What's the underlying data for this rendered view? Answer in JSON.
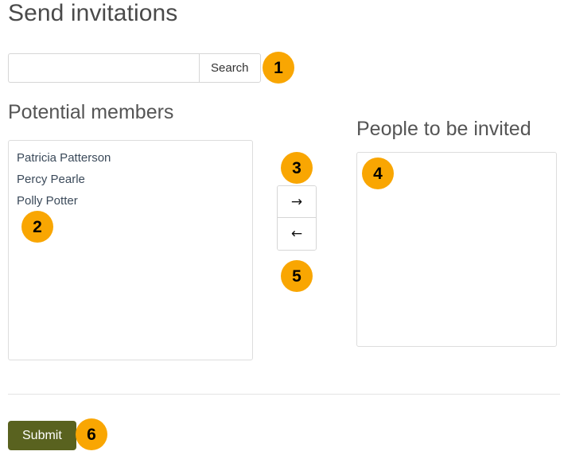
{
  "page": {
    "title": "Send invitations"
  },
  "search": {
    "value": "",
    "placeholder": "",
    "button_label": "Search"
  },
  "potential_members": {
    "heading": "Potential members",
    "options": [
      "Patricia Patterson",
      "Percy Pearle",
      "Polly Potter"
    ]
  },
  "invited": {
    "heading": "People to be invited",
    "options": []
  },
  "transfer_buttons": {
    "add_label": "→",
    "remove_label": "←",
    "add_icon": "arrow-right-icon",
    "remove_icon": "arrow-left-icon"
  },
  "form": {
    "submit_label": "Submit"
  },
  "callouts": [
    {
      "number": "1"
    },
    {
      "number": "2"
    },
    {
      "number": "3"
    },
    {
      "number": "4"
    },
    {
      "number": "5"
    },
    {
      "number": "6"
    }
  ],
  "colors": {
    "badge_background": "#f9a602",
    "badge_text": "#000000",
    "submit_background": "#59621f",
    "submit_text": "#ffffff",
    "heading_text": "#555555",
    "option_text": "#3b4a5a",
    "border": "#dddddd"
  }
}
